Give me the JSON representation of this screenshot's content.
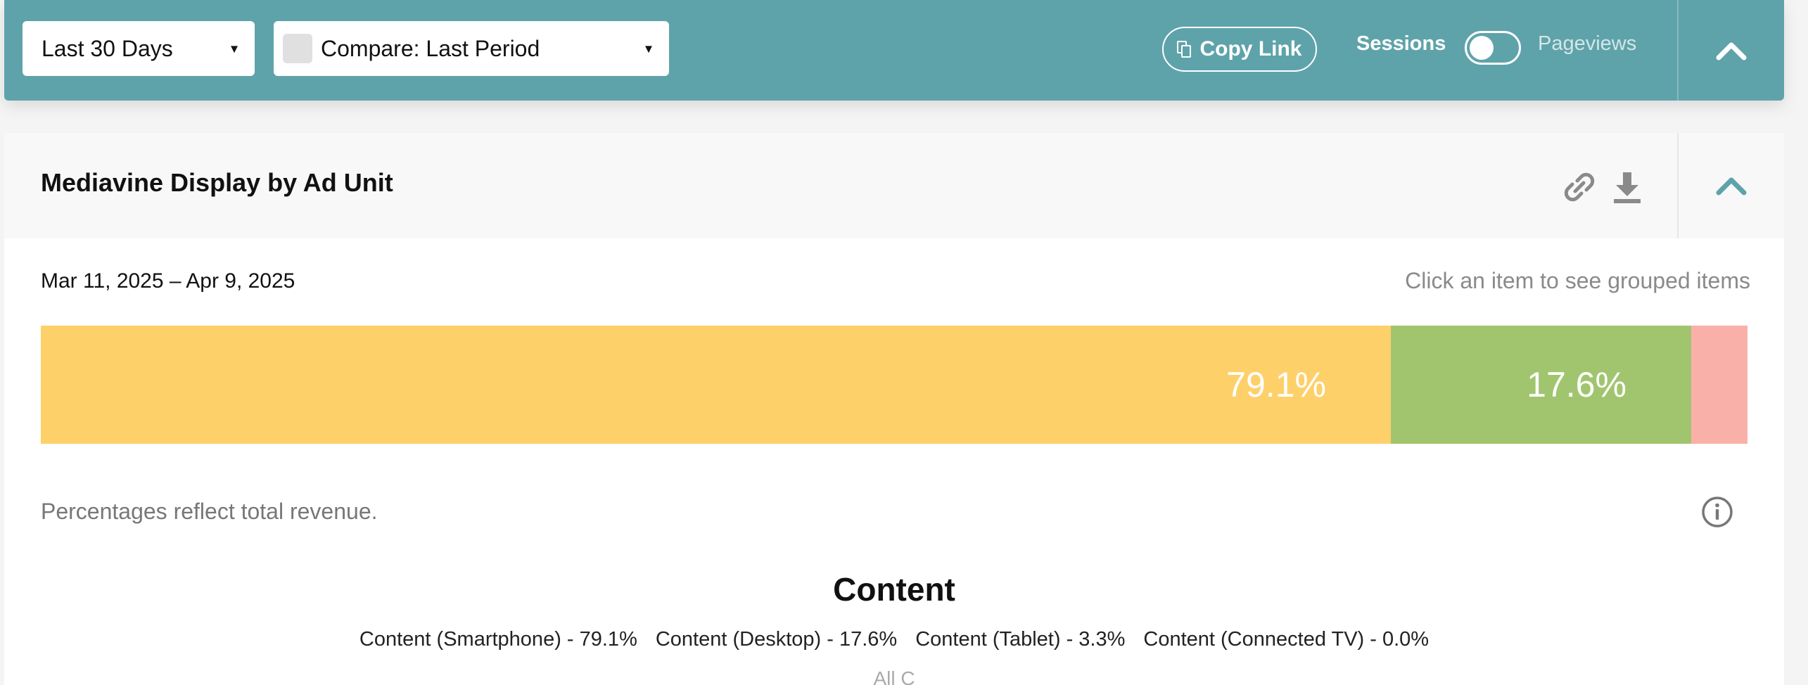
{
  "toolbar": {
    "date_range_label": "Last 30 Days",
    "compare_label": "Compare: Last Period",
    "compare_checked": false,
    "copy_link_label": "Copy Link",
    "sessions_label": "Sessions",
    "pageviews_label": "Pageviews",
    "toggle_state": "sessions",
    "caret": "▾"
  },
  "card": {
    "title": "Mediavine Display by Ad Unit",
    "date_range": "Mar 11, 2025 – Apr 9, 2025",
    "hint": "Click an item to see grouped items",
    "note": "Percentages reflect total revenue.",
    "legend_title": "Content",
    "legend_items": [
      "Content (Smartphone) - 79.1%",
      "Content (Desktop) - 17.6%",
      "Content (Tablet) - 3.3%",
      "Content (Connected TV) - 0.0%"
    ],
    "all_text": "All C"
  },
  "chart_data": {
    "type": "bar",
    "orientation": "stacked-horizontal",
    "categories": [
      "Content (Smartphone)",
      "Content (Desktop)",
      "Content (Tablet)",
      "Content (Connected TV)"
    ],
    "values": [
      79.1,
      17.6,
      3.3,
      0.0
    ],
    "labels": [
      "79.1%",
      "17.6%",
      "",
      ""
    ],
    "colors": [
      "#fed06a",
      "#a1c56f",
      "#f9b0a9",
      "#9ac8d0"
    ]
  },
  "colors": {
    "toolbar_bg": "#5fa3aa",
    "accent": "#5fa3aa",
    "icon_gray": "#888888"
  }
}
